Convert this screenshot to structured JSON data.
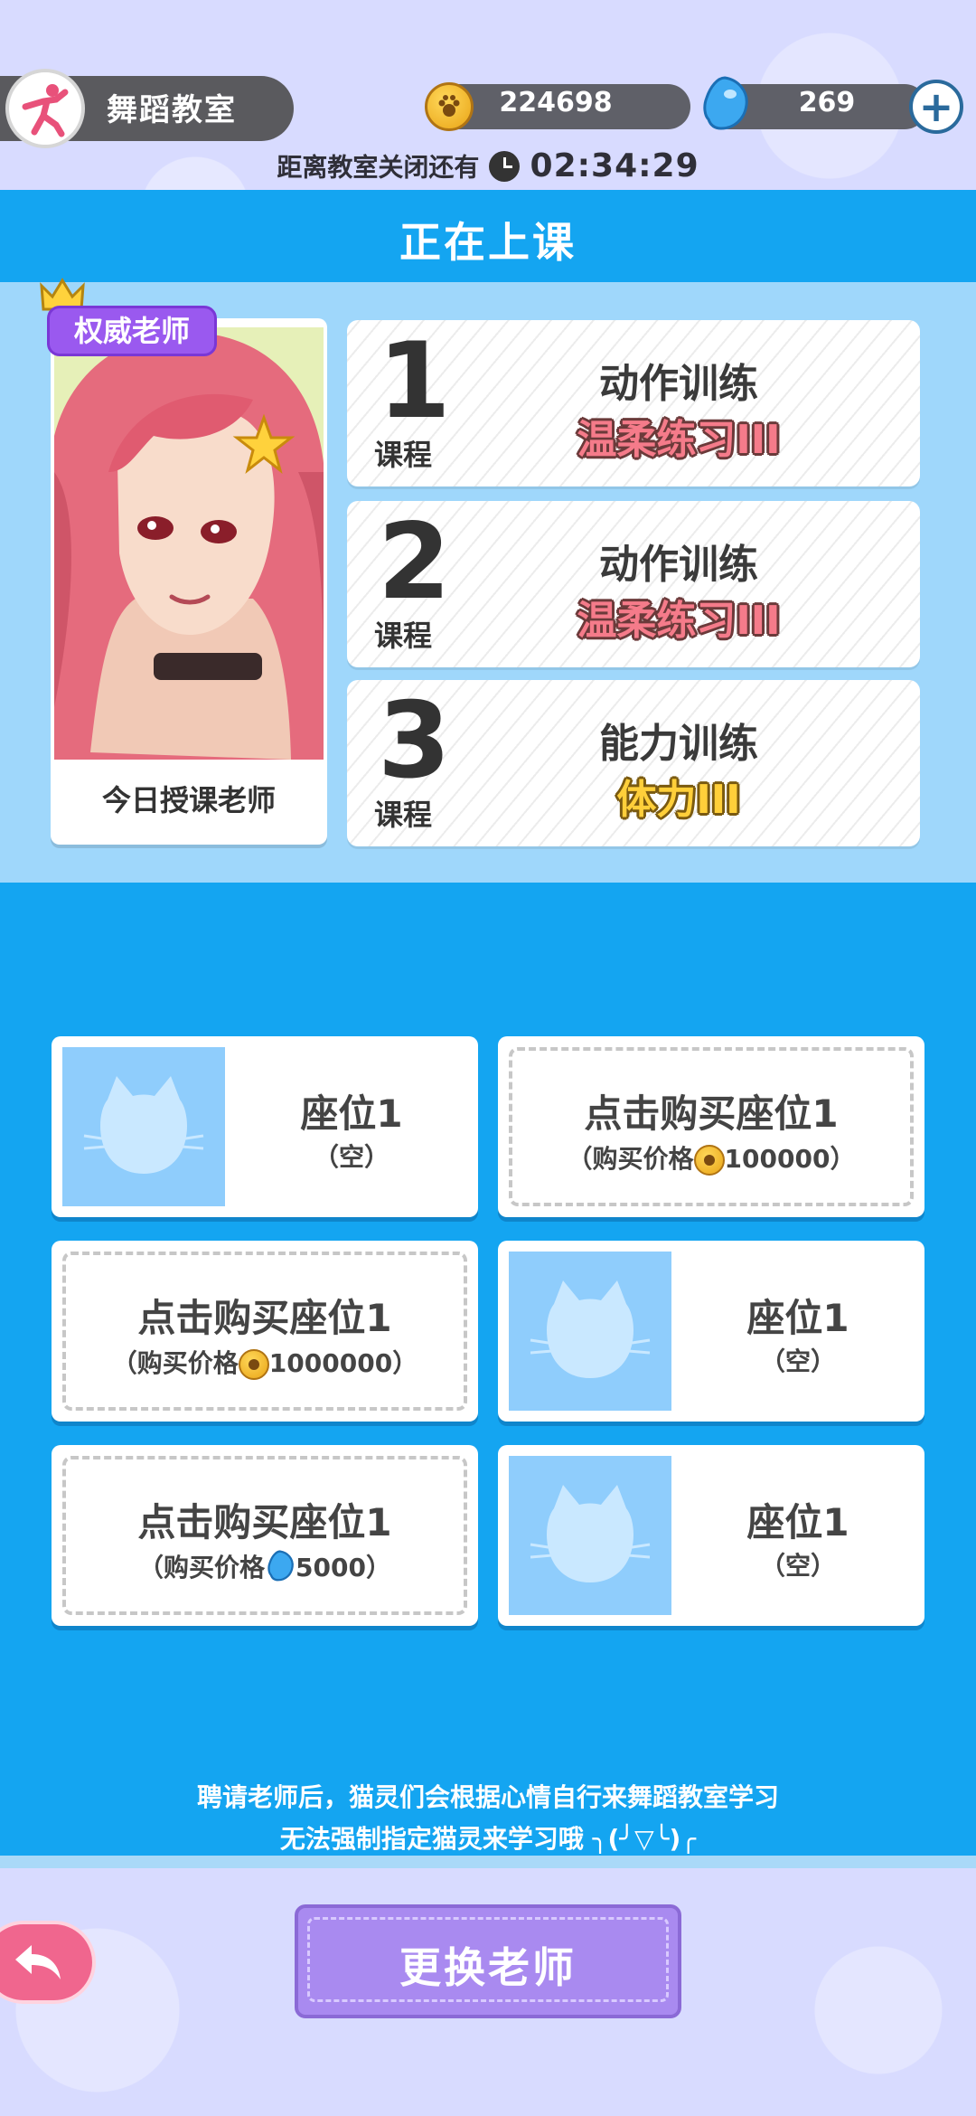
{
  "top_bar": {
    "title": "舞蹈教室",
    "coins": "224698",
    "gems": "269",
    "add_label": "+"
  },
  "countdown": {
    "label": "距离教室关闭还有",
    "time": "02:34:29"
  },
  "header": {
    "title": "正在上课"
  },
  "teacher": {
    "badge": "权威老师",
    "caption": "今日授课老师"
  },
  "courses": [
    {
      "number": "1",
      "unit": "课程",
      "category": "动作训练",
      "name": "温柔练习III",
      "name_color": "pink"
    },
    {
      "number": "2",
      "unit": "课程",
      "category": "动作训练",
      "name": "温柔练习III",
      "name_color": "pink"
    },
    {
      "number": "3",
      "unit": "课程",
      "category": "能力训练",
      "name": "体力III",
      "name_color": "gold"
    }
  ],
  "seats": [
    {
      "type": "occupied",
      "title": "座位1",
      "status": "（空）"
    },
    {
      "type": "buy",
      "title": "点击购买座位1",
      "price_prefix": "（购买价格",
      "currency": "coin",
      "price": "100000",
      "price_suffix": "）"
    },
    {
      "type": "buy",
      "title": "点击购买座位1",
      "price_prefix": "（购买价格",
      "currency": "coin",
      "price": "1000000",
      "price_suffix": "）"
    },
    {
      "type": "occupied",
      "title": "座位1",
      "status": "（空）"
    },
    {
      "type": "buy",
      "title": "点击购买座位1",
      "price_prefix": "（购买价格",
      "currency": "gem",
      "price": "5000",
      "price_suffix": "）"
    },
    {
      "type": "occupied",
      "title": "座位1",
      "status": "（空）"
    }
  ],
  "note": {
    "line1": "聘请老师后，猫灵们会根据心情自行来舞蹈教室学习",
    "line2": "无法强制指定猫灵来学习哦 ╮(╯▽╰)╭"
  },
  "buttons": {
    "change_teacher": "更换老师"
  },
  "colors": {
    "band_blue": "#14a5f1",
    "panel_light_blue": "#9fd7fb",
    "badge_purple": "#9a59ef",
    "button_purple": "#a98af0",
    "back_pink": "#f0668e"
  }
}
